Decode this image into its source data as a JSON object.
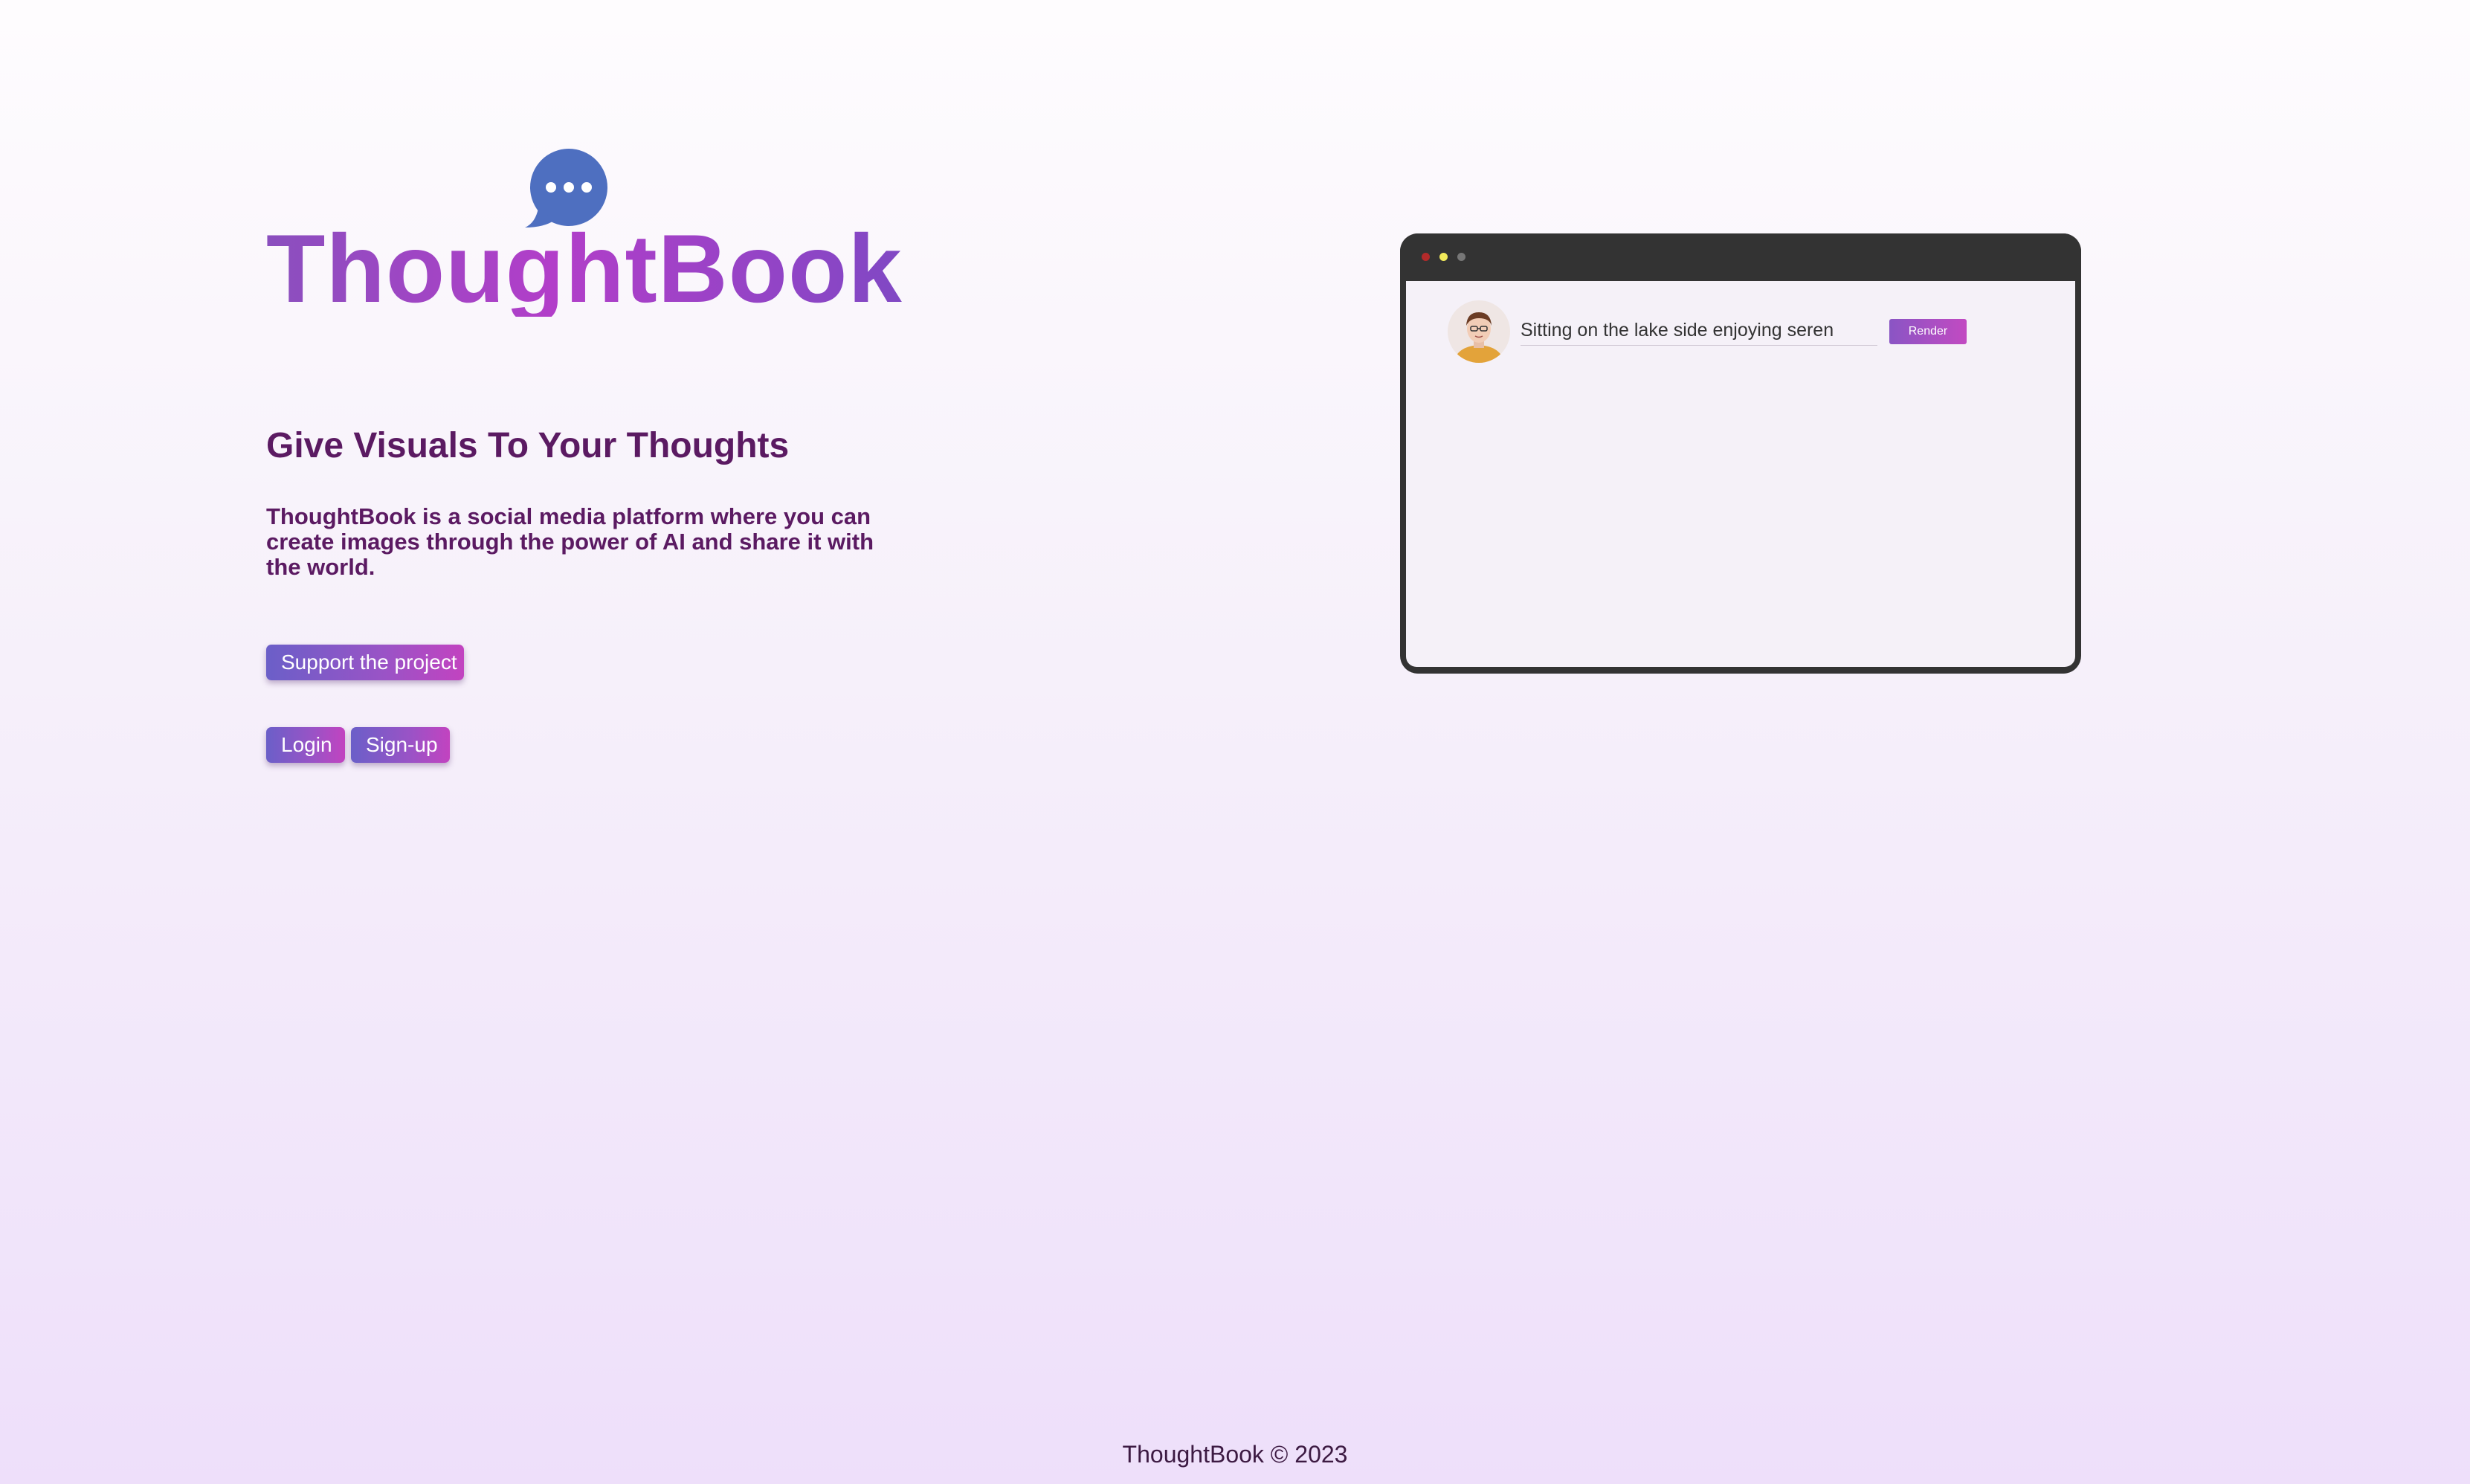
{
  "brand": {
    "name": "ThoughtBook",
    "logo_icon": "speech-bubble-icon",
    "logo_color": "#4e6fc0"
  },
  "hero": {
    "tagline": "Give Visuals To Your Thoughts",
    "description": "ThoughtBook is a social media platform where you can create images through the power of AI and share it with the world."
  },
  "buttons": {
    "support": "Support the project",
    "login": "Login",
    "signup": "Sign-up"
  },
  "preview": {
    "prompt_value": "Sitting on the lake side enjoying seren",
    "render_label": "Render"
  },
  "footer": {
    "text": "ThoughtBook © 2023"
  },
  "colors": {
    "accent_start": "#6b5fc8",
    "accent_end": "#c243c0",
    "text_dark": "#5b1a62"
  }
}
